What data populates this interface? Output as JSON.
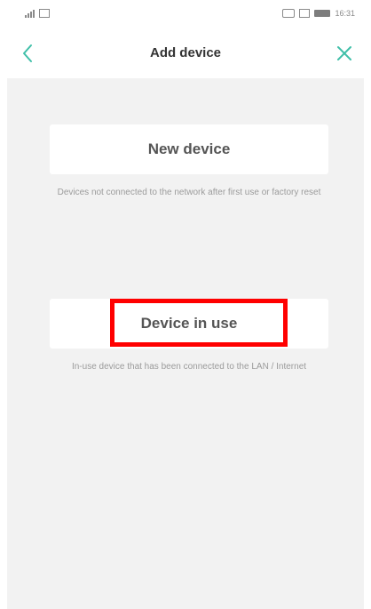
{
  "status_bar": {
    "left_text": "",
    "right_time": "16:31"
  },
  "header": {
    "title": "Add device",
    "back_icon": "chevron-left-icon",
    "close_icon": "close-icon",
    "accent": "#3fbfa8"
  },
  "options": [
    {
      "label": "New device",
      "description": "Devices not connected to the network after first use or factory reset"
    },
    {
      "label": "Device in use",
      "description": "In-use device that has been connected to the LAN / Internet"
    }
  ],
  "highlight_color": "#ff0000"
}
